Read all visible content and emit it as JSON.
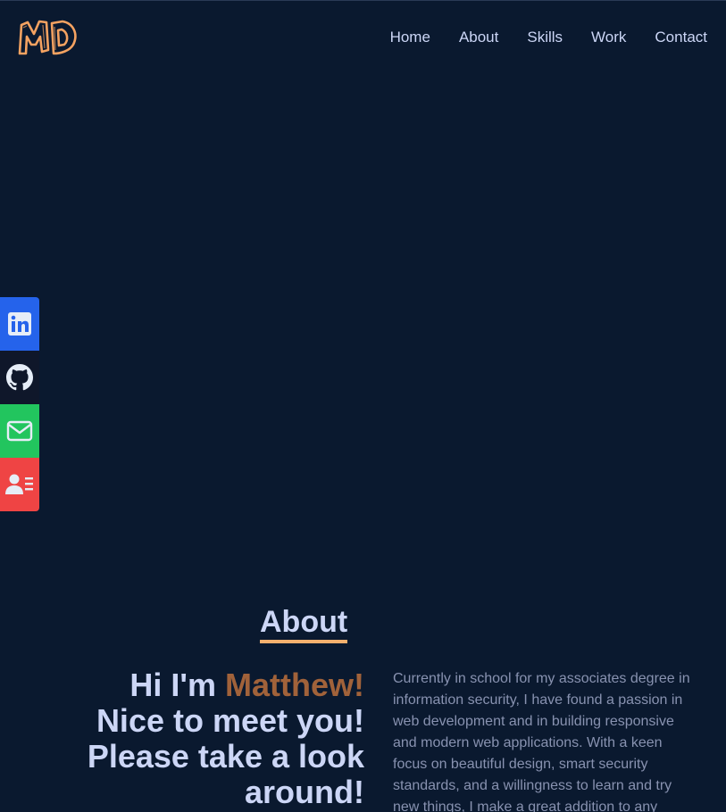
{
  "header": {
    "logo_text": "MD",
    "nav": [
      {
        "label": "Home"
      },
      {
        "label": "About"
      },
      {
        "label": "Skills"
      },
      {
        "label": "Work"
      },
      {
        "label": "Contact"
      }
    ]
  },
  "social": [
    {
      "name": "linkedin",
      "icon": "linkedin-icon",
      "color": "#2563eb"
    },
    {
      "name": "github",
      "icon": "github-icon",
      "color": "#0f172a"
    },
    {
      "name": "email",
      "icon": "mail-icon",
      "color": "#22c55e"
    },
    {
      "name": "resume",
      "icon": "contact-card-icon",
      "color": "#ef4444"
    }
  ],
  "about": {
    "title": "About",
    "greeting_prefix": "Hi I'm ",
    "name": "Matthew!",
    "greeting_rest": "Nice to meet you! Please take a look around!",
    "bio": "Currently in school for my associates degree in information security, I have found a passion in web development and in building responsive and modern web applications. With a keen focus on beautiful design, smart security standards, and a willingness to learn and try new things, I make a great addition to any"
  },
  "colors": {
    "background": "#0a192f",
    "text": "#ccd6f6",
    "muted": "#8892b0",
    "accent": "#f5b06e",
    "name_accent": "#a1623a"
  }
}
